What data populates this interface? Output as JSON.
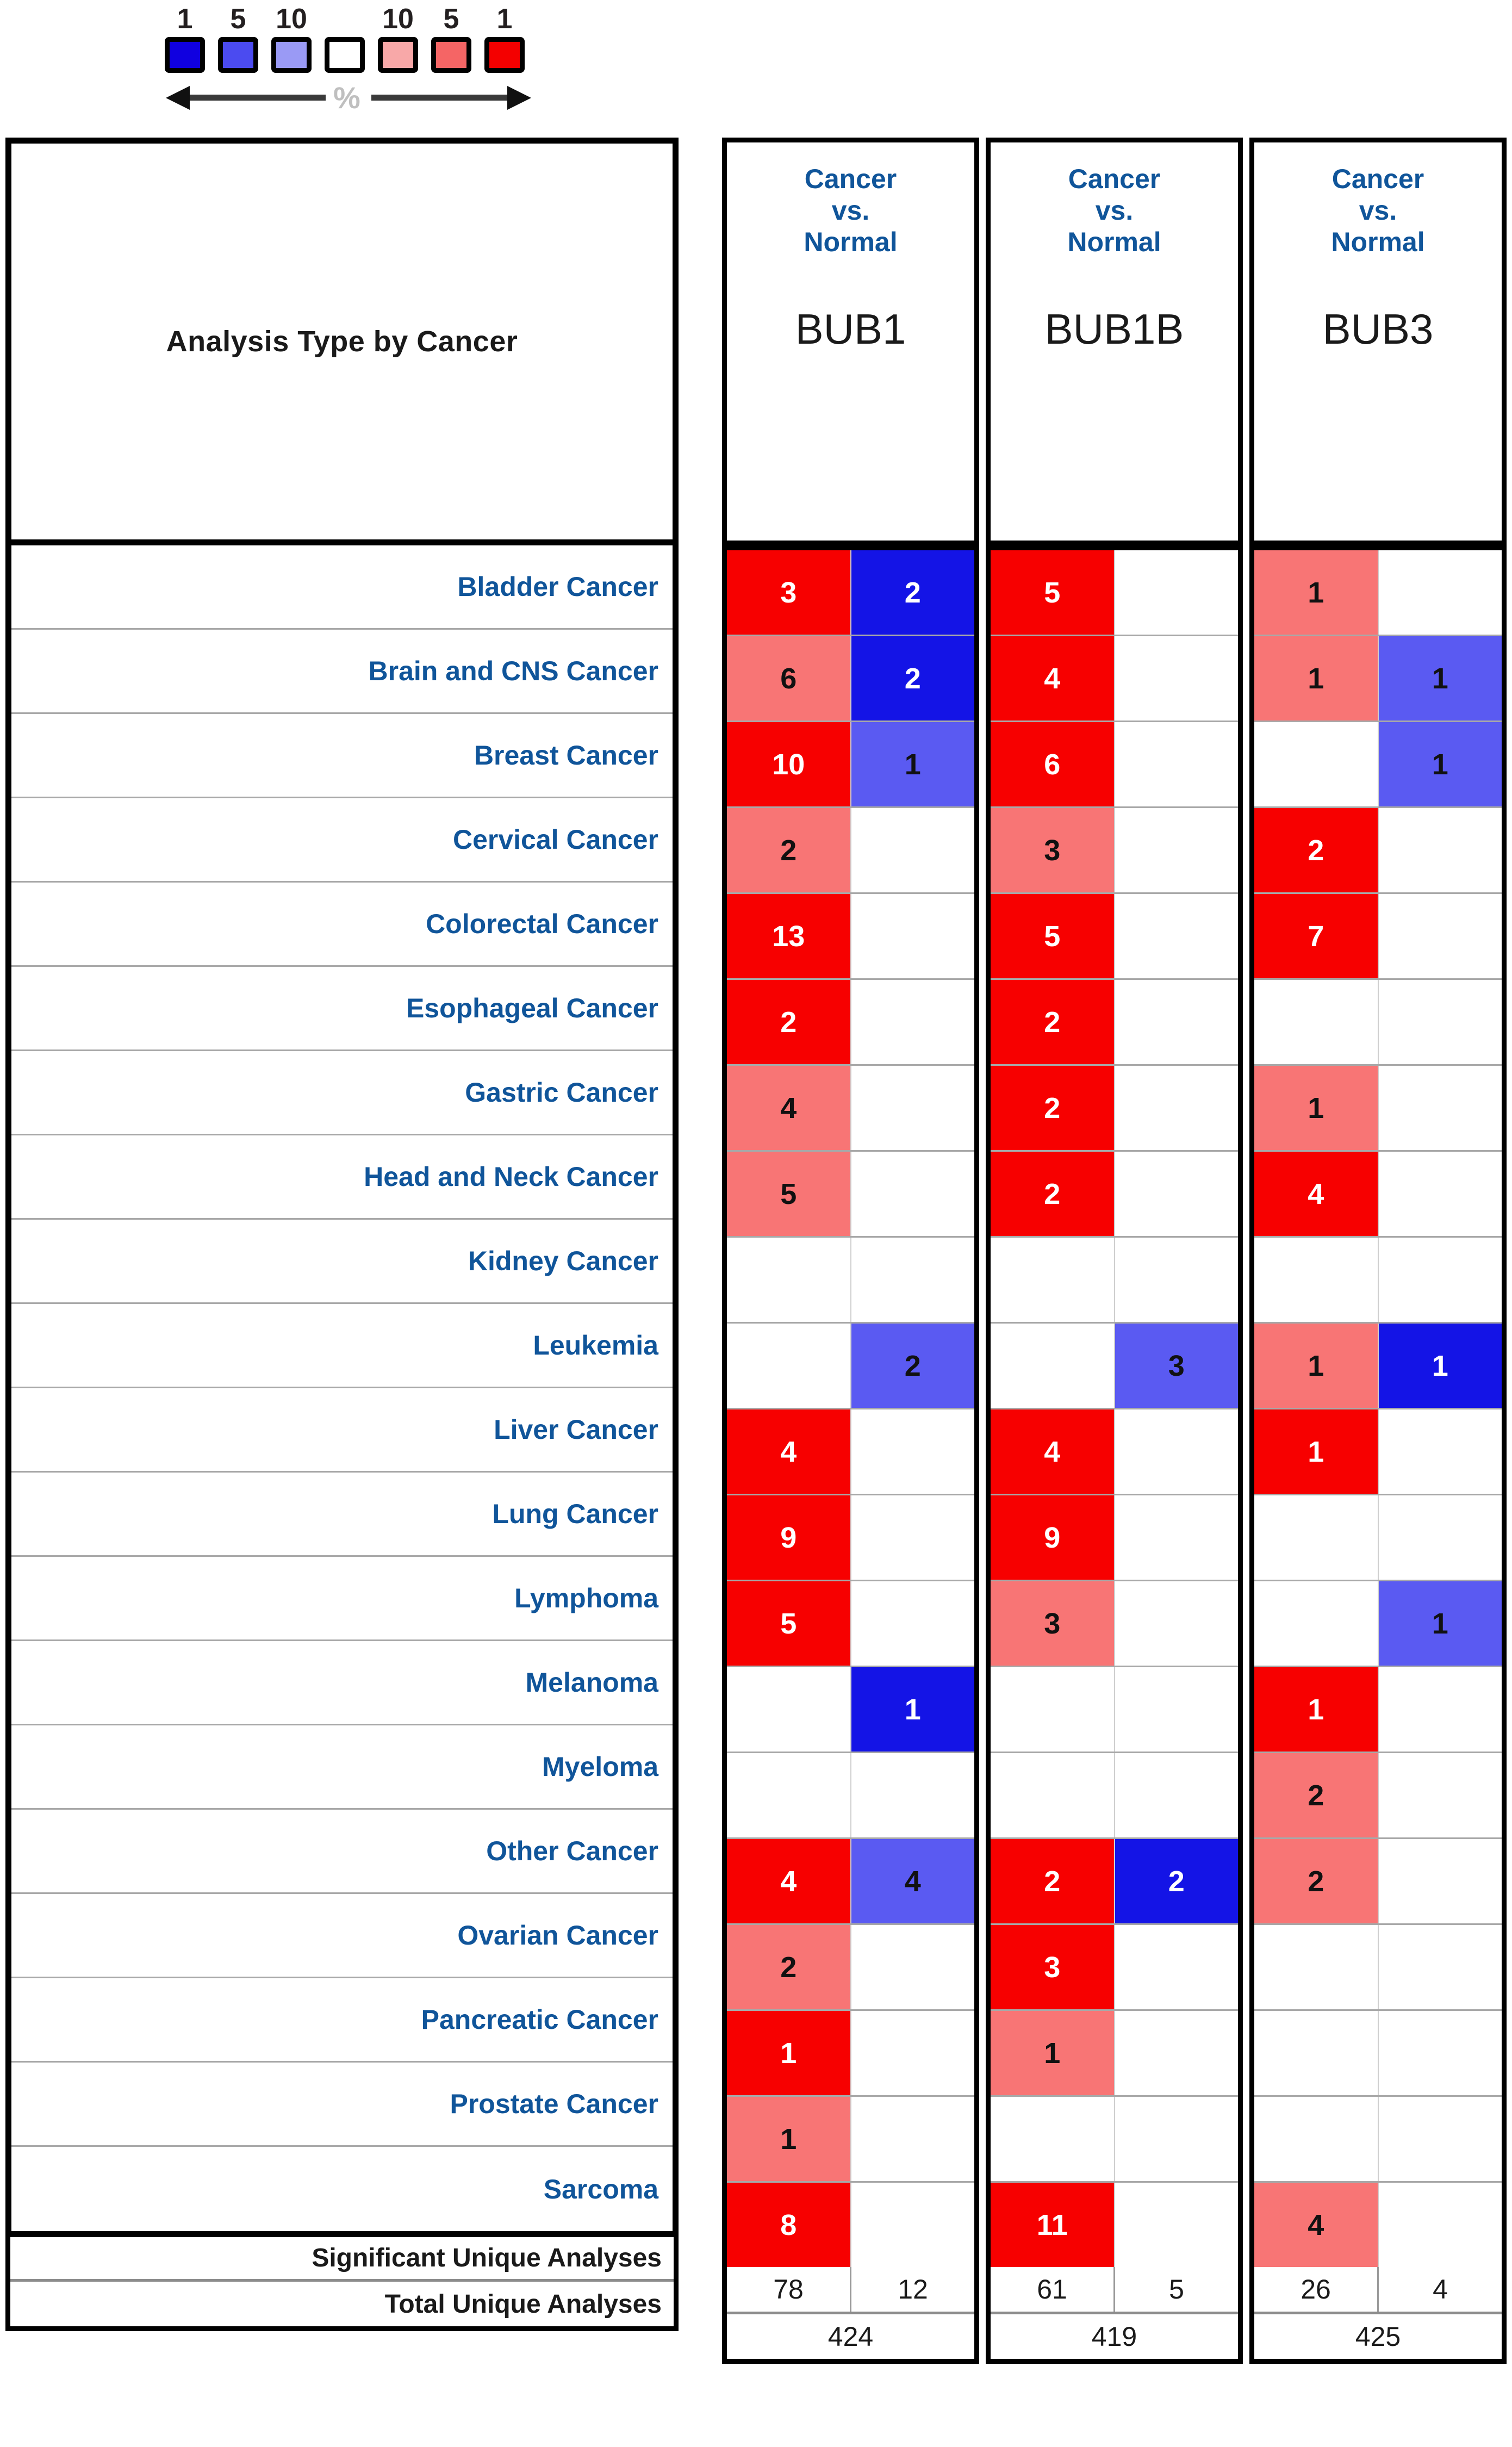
{
  "legend": {
    "labels": [
      "1",
      "5",
      "10",
      "",
      "10",
      "5",
      "1"
    ],
    "swatch_colors": [
      "#1000e0",
      "#4b4bf0",
      "#9a9af5",
      "#ffffff",
      "#f8a8a8",
      "#f56565",
      "#f40000"
    ],
    "center_symbol": "%",
    "left_arrow_name": "under-expression-arrow",
    "right_arrow_name": "over-expression-arrow"
  },
  "header": {
    "left_title": "Analysis Type by Cancer",
    "comparison": "Cancer\nvs.\nNormal",
    "comparison_line1": "Cancer",
    "comparison_line2": "vs.",
    "comparison_line3": "Normal"
  },
  "genes": [
    "BUB1",
    "BUB1B",
    "BUB3"
  ],
  "cancer_types": [
    "Bladder Cancer",
    "Brain and CNS Cancer",
    "Breast Cancer",
    "Cervical Cancer",
    "Colorectal Cancer",
    "Esophageal Cancer",
    "Gastric Cancer",
    "Head and Neck Cancer",
    "Kidney Cancer",
    "Leukemia",
    "Liver Cancer",
    "Lung Cancer",
    "Lymphoma",
    "Melanoma",
    "Myeloma",
    "Other Cancer",
    "Ovarian Cancer",
    "Pancreatic Cancer",
    "Prostate Cancer",
    "Sarcoma"
  ],
  "footer": {
    "significant_label": "Significant Unique Analyses",
    "total_label": "Total Unique Analyses",
    "significant": [
      {
        "gene": "BUB1",
        "over": "78",
        "under": "12"
      },
      {
        "gene": "BUB1B",
        "over": "61",
        "under": "5"
      },
      {
        "gene": "BUB3",
        "over": "26",
        "under": "4"
      }
    ],
    "totals": [
      "424",
      "419",
      "425"
    ]
  },
  "colors": {
    "over_strong": "#f70000",
    "over_weak": "#f87575",
    "under_strong": "#1414e6",
    "under_weak": "#5a5af2",
    "empty": "#ffffff",
    "label_blue": "#10559a",
    "grid": "#a8a8a8",
    "border": "#000000"
  },
  "chart_data": {
    "type": "heatmap",
    "title": "Analysis Type by Cancer",
    "subtitle": "Cancer vs. Normal",
    "xlabel": "",
    "ylabel": "",
    "legend": {
      "description": "Gene rank percentile within each analysis; left side blue = under-expression, right side red = over-expression",
      "tick_labels": [
        "1",
        "5",
        "10",
        "",
        "10",
        "5",
        "1"
      ],
      "unit": "%",
      "position": "top-left"
    },
    "columns": [
      "BUB1",
      "BUB1B",
      "BUB3"
    ],
    "subcolumns": [
      "over-expression",
      "under-expression"
    ],
    "categories": [
      "Bladder Cancer",
      "Brain and CNS Cancer",
      "Breast Cancer",
      "Cervical Cancer",
      "Colorectal Cancer",
      "Esophageal Cancer",
      "Gastric Cancer",
      "Head and Neck Cancer",
      "Kidney Cancer",
      "Leukemia",
      "Liver Cancer",
      "Lung Cancer",
      "Lymphoma",
      "Melanoma",
      "Myeloma",
      "Other Cancer",
      "Ovarian Cancer",
      "Pancreatic Cancer",
      "Prostate Cancer",
      "Sarcoma"
    ],
    "cells": {
      "BUB1": {
        "over": [
          "3",
          "6",
          "10",
          "2",
          "13",
          "2",
          "4",
          "5",
          "",
          "",
          "4",
          "9",
          "5",
          "",
          "",
          "4",
          "2",
          "1",
          "1",
          "8"
        ],
        "over_intensity": [
          "strong",
          "weak",
          "strong",
          "weak",
          "strong",
          "strong",
          "weak",
          "weak",
          "",
          "",
          "strong",
          "strong",
          "strong",
          "",
          "",
          "strong",
          "weak",
          "strong",
          "weak",
          "strong"
        ],
        "under": [
          "2",
          "2",
          "1",
          "",
          "",
          "",
          "",
          "",
          "",
          "2",
          "",
          "",
          "",
          "1",
          "",
          "4",
          "",
          "",
          "",
          ""
        ],
        "under_intensity": [
          "strong",
          "strong",
          "medium",
          "",
          "",
          "",
          "",
          "",
          "",
          "medium",
          "",
          "",
          "",
          "strong",
          "",
          "medium",
          "",
          "",
          "",
          ""
        ]
      },
      "BUB1B": {
        "over": [
          "5",
          "4",
          "6",
          "3",
          "5",
          "2",
          "2",
          "2",
          "",
          "",
          "4",
          "9",
          "3",
          "",
          "",
          "2",
          "3",
          "1",
          "",
          "11"
        ],
        "over_intensity": [
          "strong",
          "strong",
          "strong",
          "weak",
          "strong",
          "strong",
          "strong",
          "strong",
          "",
          "",
          "strong",
          "strong",
          "weak",
          "",
          "",
          "strong",
          "strong",
          "weak",
          "",
          "strong"
        ],
        "under": [
          "",
          "",
          "",
          "",
          "",
          "",
          "",
          "",
          "",
          "3",
          "",
          "",
          "",
          "",
          "",
          "2",
          "",
          "",
          "",
          ""
        ],
        "under_intensity": [
          "",
          "",
          "",
          "",
          "",
          "",
          "",
          "",
          "",
          "medium",
          "",
          "",
          "",
          "",
          "",
          "strong",
          "",
          "",
          "",
          ""
        ]
      },
      "BUB3": {
        "over": [
          "1",
          "1",
          "",
          "2",
          "7",
          "",
          "1",
          "4",
          "",
          "1",
          "1",
          "",
          "",
          "1",
          "2",
          "2",
          "",
          "",
          "",
          "4"
        ],
        "over_intensity": [
          "weak",
          "weak",
          "",
          "strong",
          "strong",
          "",
          "weak",
          "strong",
          "",
          "weak",
          "strong",
          "",
          "",
          "strong",
          "weak",
          "weak",
          "",
          "",
          "",
          "weak"
        ],
        "under": [
          "",
          "1",
          "1",
          "",
          "",
          "",
          "",
          "",
          "",
          "1",
          "",
          "",
          "1",
          "",
          "",
          "",
          "",
          "",
          "",
          ""
        ],
        "under_intensity": [
          "",
          "medium",
          "medium",
          "",
          "",
          "",
          "",
          "",
          "",
          "strong",
          "",
          "",
          "medium",
          "",
          "",
          "",
          "",
          "",
          "",
          ""
        ]
      }
    },
    "summary": {
      "significant_unique_analyses": {
        "BUB1": {
          "over": 78,
          "under": 12
        },
        "BUB1B": {
          "over": 61,
          "under": 5
        },
        "BUB3": {
          "over": 26,
          "under": 4
        }
      },
      "total_unique_analyses": {
        "BUB1": 424,
        "BUB1B": 419,
        "BUB3": 425
      }
    }
  }
}
